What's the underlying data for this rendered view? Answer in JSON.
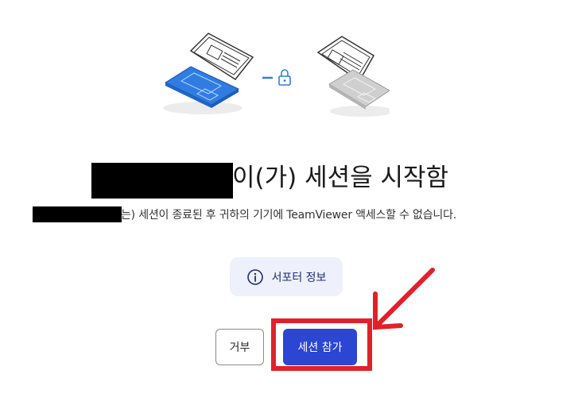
{
  "session": {
    "title_suffix": "이(가) 세션을 시작함",
    "subtitle_suffix": "는) 세션이 종료된 후 귀하의 기기에 TeamViewer 액세스할 수 없습니다."
  },
  "supporter_info": {
    "label": "서포터 정보",
    "icon": "info-icon"
  },
  "actions": {
    "decline_label": "거부",
    "join_label": "세션 참가"
  },
  "colors": {
    "primary": "#2a46d2",
    "annotation": "#e0212a",
    "info_bg": "#eef1fb",
    "laptop_blue": "#2f7de1"
  }
}
